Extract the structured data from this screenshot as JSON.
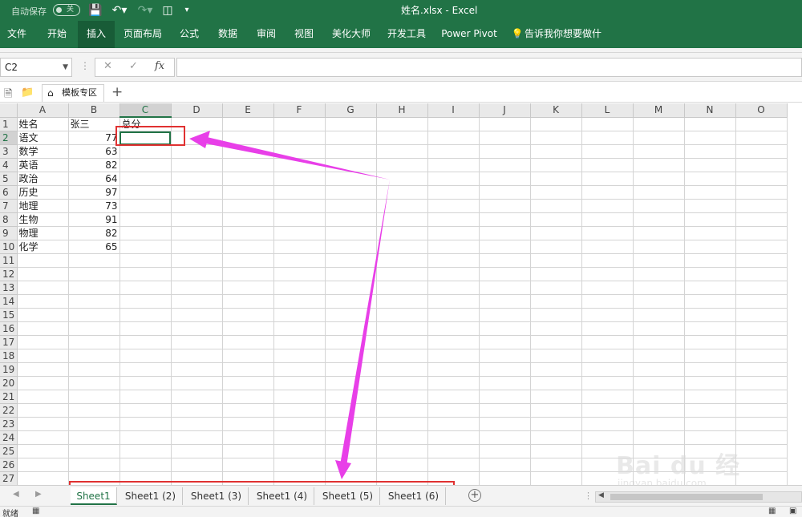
{
  "window": {
    "autosave_label": "自动保存",
    "autosave_state": "关",
    "file_title": "姓名.xlsx  -  Excel"
  },
  "ribbon": {
    "tabs": [
      "文件",
      "开始",
      "插入",
      "页面布局",
      "公式",
      "数据",
      "审阅",
      "视图",
      "美化大师",
      "开发工具",
      "Power Pivot",
      "告诉我你想要做什么"
    ],
    "active_tab": "插入"
  },
  "formula_bar": {
    "name_box": "C2",
    "fx_label": "fx",
    "cancel_glyph": "✕",
    "enter_glyph": "✓",
    "value": ""
  },
  "template_bar": {
    "tab_label": "模板专区",
    "add_label": "+"
  },
  "sheet": {
    "columns": [
      "A",
      "B",
      "C",
      "D",
      "E",
      "F",
      "G",
      "H",
      "I",
      "J",
      "K",
      "L",
      "M",
      "N",
      "O"
    ],
    "row_count": 27,
    "active_cell": "C2",
    "cells": [
      [
        "姓名",
        "张三",
        "总分"
      ],
      [
        "语文",
        "77",
        ""
      ],
      [
        "数学",
        "63",
        ""
      ],
      [
        "英语",
        "82",
        ""
      ],
      [
        "政治",
        "64",
        ""
      ],
      [
        "历史",
        "97",
        ""
      ],
      [
        "地理",
        "73",
        ""
      ],
      [
        "生物",
        "91",
        ""
      ],
      [
        "物理",
        "82",
        ""
      ],
      [
        "化学",
        "65",
        ""
      ]
    ]
  },
  "sheet_tabs": [
    "Sheet1",
    "Sheet1 (2)",
    "Sheet1 (3)",
    "Sheet1 (4)",
    "Sheet1 (5)",
    "Sheet1 (6)"
  ],
  "active_sheet_tab": "Sheet1",
  "status": {
    "ready_label": "就绪"
  },
  "watermark": {
    "brand": "Bai du 经验",
    "url": "jingyan.baidu.com"
  },
  "colors": {
    "excel_green": "#217346",
    "annotation_red": "#e03131",
    "arrow_magenta": "#e83fe8"
  }
}
